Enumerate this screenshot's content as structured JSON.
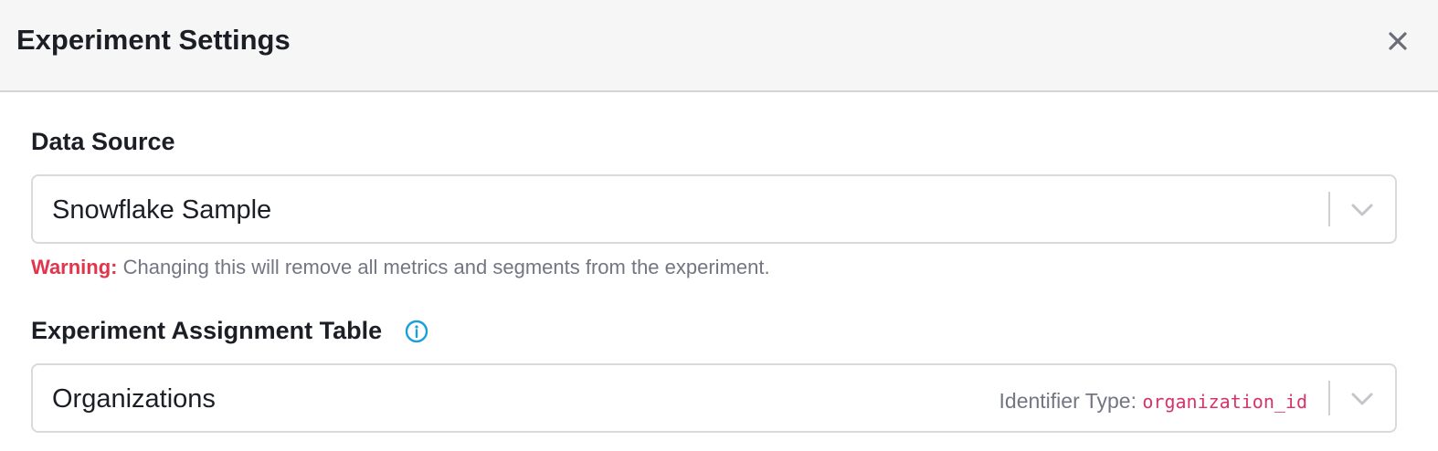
{
  "modal": {
    "title": "Experiment Settings",
    "close_icon": "close-icon"
  },
  "data_source": {
    "label": "Data Source",
    "value": "Snowflake Sample",
    "warning_prefix": "Warning:",
    "warning_text": "Changing this will remove all metrics and segments from the experiment."
  },
  "assignment_table": {
    "label": "Experiment Assignment Table",
    "info_icon": "info-circle-icon",
    "value": "Organizations",
    "identifier_label": "Identifier Type:",
    "identifier_value": "organization_id"
  },
  "colors": {
    "warning": "#e0354a",
    "info": "#1a9fd9",
    "code": "#d6336c",
    "header_bg": "#f6f6f7"
  }
}
